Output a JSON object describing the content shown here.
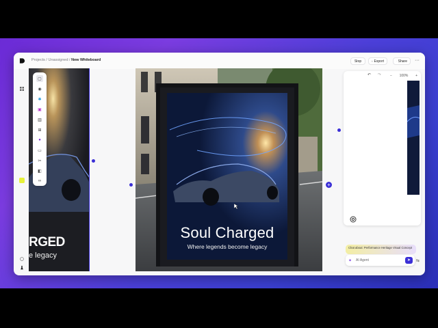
{
  "breadcrumb": {
    "projects": "Projects",
    "sep1": "/",
    "unassigned": "Unassigned",
    "sep2": "/",
    "current": "New Whiteboard"
  },
  "header": {
    "stop_label": "Stop",
    "export_label": "Export",
    "share_label": "Share",
    "more_label": "···"
  },
  "zoom": {
    "level": "100%",
    "minus": "−",
    "plus": "+"
  },
  "toolbar_icons": [
    "select-icon",
    "sticky-icon",
    "sparkle-icon",
    "image-icon",
    "chart-icon",
    "frame-icon",
    "ai-icon",
    "video-icon",
    "scissors-icon",
    "layers-icon",
    "link-icon"
  ],
  "poster_main": {
    "headline": "Soul Charged",
    "tagline": "Where legends become legacy"
  },
  "poster_left": {
    "headline": "RGED",
    "tagline": "e legacy"
  },
  "agent": {
    "hint_prefix": "Chat about:",
    "hint_subject": "Performance Heritage Visual Concept",
    "placeholder": "AI Agent"
  },
  "colors": {
    "accent": "#3b2fd6",
    "bg_purple": "#6b2bd6",
    "highlight": "#e6f13a"
  }
}
